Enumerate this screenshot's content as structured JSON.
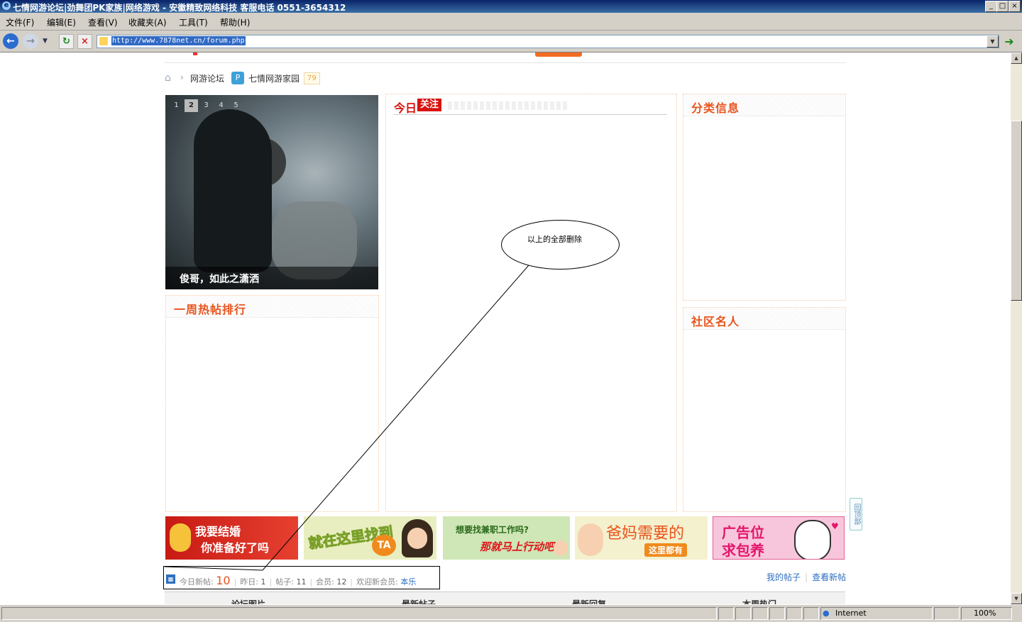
{
  "window": {
    "title": "七情网游论坛|劲舞团PK家族|网络游戏 - 安徽精致网络科技    客服电话 0551-3654312",
    "buttons": [
      "_",
      "□",
      "×"
    ]
  },
  "menu": [
    "文件(F)",
    "编辑(E)",
    "查看(V)",
    "收藏夹(A)",
    "工具(T)",
    "帮助(H)"
  ],
  "address": {
    "url": "http://www.7878net.cn/forum.php"
  },
  "breadcrumb": {
    "forum": "网游论坛",
    "home_name": "七情网游家园",
    "count": "79"
  },
  "slideshow": {
    "pages": [
      "1",
      "2",
      "3",
      "4",
      "5"
    ],
    "active_page": 2,
    "caption": "俊哥，如此之潇洒"
  },
  "sections": {
    "weekly_hot": "一周热帖排行",
    "today_label": "今日",
    "today_badge": "关注",
    "classified": "分类信息",
    "celebrities": "社区名人"
  },
  "annotation": {
    "text": "以上的全部删除"
  },
  "banners": [
    {
      "line1": "我要结婚",
      "line2": "你准备好了吗",
      "bg": "#d7281c"
    },
    {
      "line1": "就在这里找到",
      "line2": "TA",
      "bg": "#e9eec0"
    },
    {
      "line1": "想要找兼职工作吗?",
      "line2": "那就马上行动吧!",
      "bg": "#cfe6b6"
    },
    {
      "line1": "爸妈需要的",
      "line2": "这里都有",
      "bg": "#f4f1cf"
    },
    {
      "line1": "广告位",
      "line2": "求包养",
      "bg": "#f8c6dc"
    }
  ],
  "stats": {
    "today_label": "今日新帖:",
    "today_value": "10",
    "yesterday_label": "昨日:",
    "yesterday_value": "1",
    "posts_label": "帖子:",
    "posts_value": "11",
    "members_label": "会员:",
    "members_value": "12",
    "welcome_label": "欢迎新会员:",
    "newest_member": "本乐"
  },
  "links": {
    "my_posts": "我的帖子",
    "new_posts": "查看新帖"
  },
  "tabs": [
    "论坛图片",
    "最新帖子",
    "最新回复",
    "本周热门"
  ],
  "back_to_top": "回顶部",
  "statusbar": {
    "zone": "Internet",
    "zoom": "100%"
  },
  "colors": {
    "accent": "#e8541c",
    "link": "#2d6fc2",
    "titlebar": "#0a246a"
  }
}
